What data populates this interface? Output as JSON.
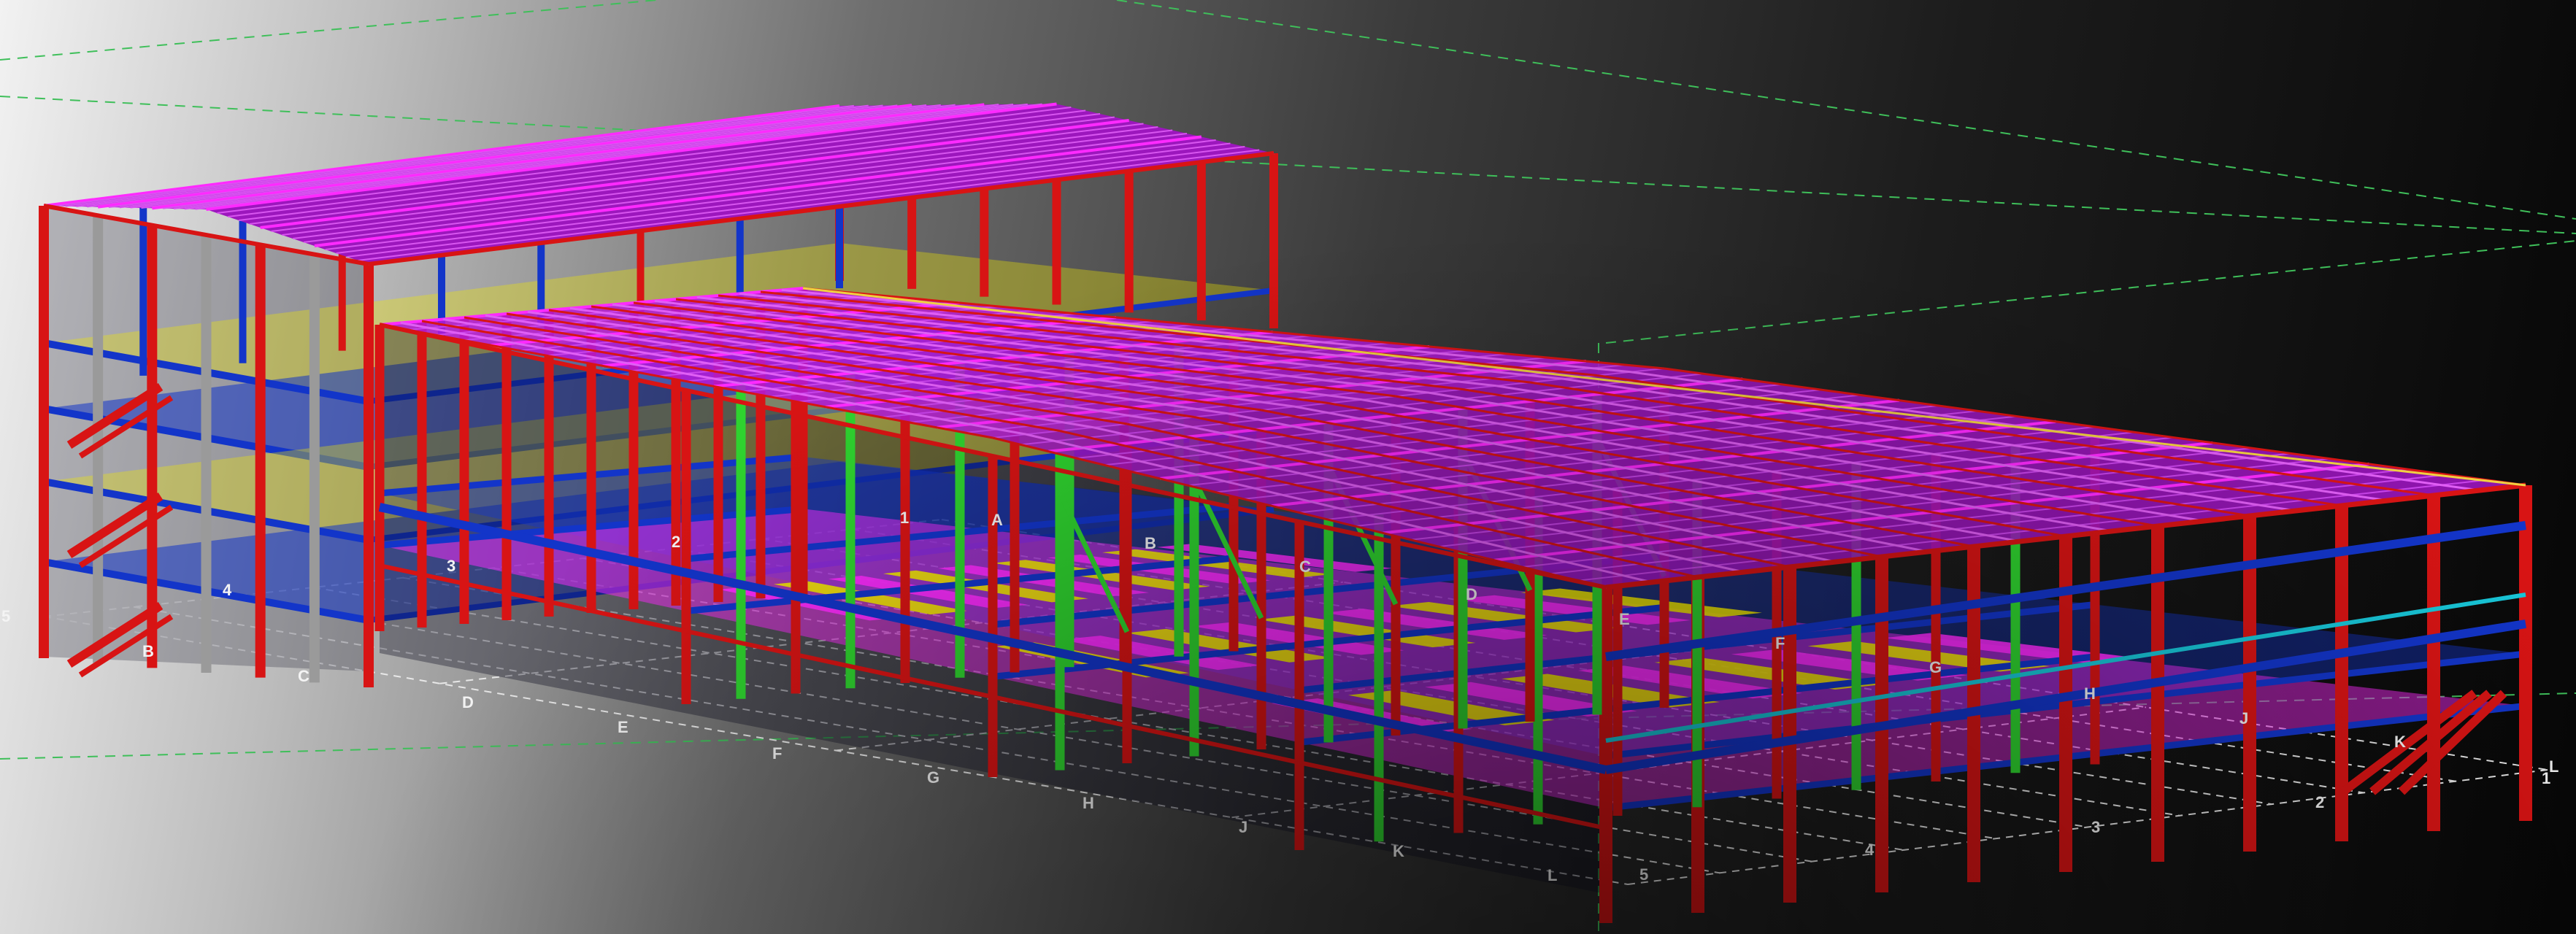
{
  "model_view": {
    "grid_labels_front": [
      "B",
      "C",
      "D",
      "E",
      "F",
      "G",
      "H",
      "J",
      "K",
      "L"
    ],
    "grid_labels_back": [
      "A",
      "B",
      "C",
      "D",
      "E",
      "F",
      "G",
      "H",
      "J",
      "K",
      "L"
    ],
    "grid_numbers_left": [
      "5",
      "4",
      "3",
      "2",
      "1"
    ],
    "grid_numbers_right": [
      "5",
      "4",
      "3",
      "2",
      "1"
    ],
    "colors": {
      "roof_purlin": "#b21ad6",
      "roof_magenta": "#ff2aff",
      "column_red": "#d81414",
      "beam_blue": "#1335c9",
      "brace_green": "#2fd32f",
      "deck_yellow": "#f2e800",
      "cyan": "#18c6d8",
      "grey_steel": "#9a9a9a",
      "gridline": "#e8e8e8",
      "grid_label": "#f4f4f4",
      "guide_line": "#3fbf5a"
    }
  }
}
